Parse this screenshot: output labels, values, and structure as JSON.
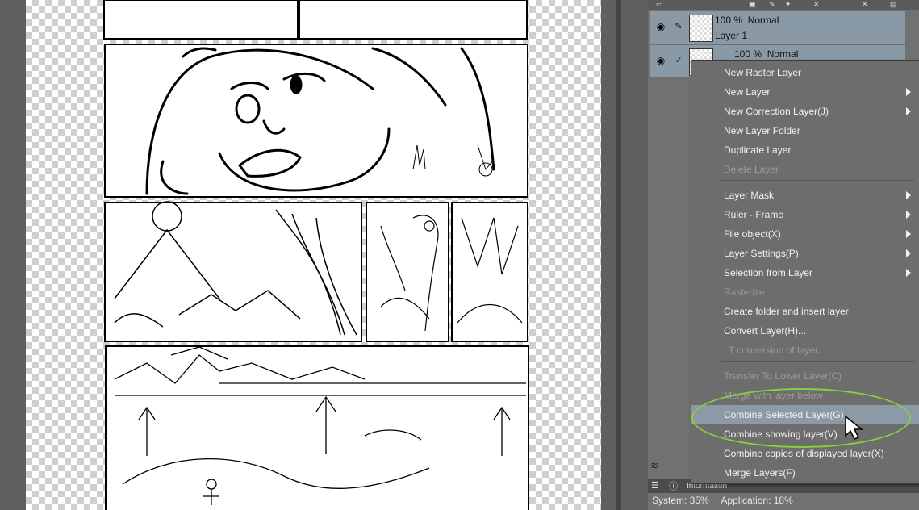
{
  "layers": [
    {
      "opacity": "100 %",
      "blend": "Normal",
      "name": "Layer 1",
      "selected": true
    },
    {
      "opacity": "100 %",
      "blend": "Normal",
      "name": "",
      "selected": true
    }
  ],
  "context_menu": {
    "items": [
      {
        "label": "New Raster Layer",
        "disabled": false,
        "submenu": false
      },
      {
        "label": "New Layer",
        "disabled": false,
        "submenu": true
      },
      {
        "label": "New Correction Layer(J)",
        "disabled": false,
        "submenu": true
      },
      {
        "label": "New Layer Folder",
        "disabled": false,
        "submenu": false
      },
      {
        "label": "Duplicate Layer",
        "disabled": false,
        "submenu": false
      },
      {
        "label": "Delete Layer",
        "disabled": true,
        "submenu": false
      },
      {
        "label": "Layer Mask",
        "disabled": false,
        "submenu": true
      },
      {
        "label": "Ruler - Frame",
        "disabled": false,
        "submenu": true
      },
      {
        "label": "File object(X)",
        "disabled": false,
        "submenu": true
      },
      {
        "label": "Layer Settings(P)",
        "disabled": false,
        "submenu": true
      },
      {
        "label": "Selection from Layer",
        "disabled": false,
        "submenu": true
      },
      {
        "label": "Rasterize",
        "disabled": true,
        "submenu": false
      },
      {
        "label": "Create folder and insert layer",
        "disabled": false,
        "submenu": false
      },
      {
        "label": "Convert Layer(H)...",
        "disabled": false,
        "submenu": false
      },
      {
        "label": "LT conversion of layer...",
        "disabled": true,
        "submenu": false
      },
      {
        "label": "Transfer To Lower Layer(C)",
        "disabled": true,
        "submenu": false
      },
      {
        "label": "Merge with layer below",
        "disabled": true,
        "submenu": false
      },
      {
        "label": "Combine Selected Layer(G)",
        "disabled": false,
        "submenu": false,
        "highlighted": true
      },
      {
        "label": "Combine showing layer(V)",
        "disabled": false,
        "submenu": false
      },
      {
        "label": "Combine copies of displayed layer(X)",
        "disabled": false,
        "submenu": false
      },
      {
        "label": "Merge Layers(F)",
        "disabled": false,
        "submenu": false
      }
    ]
  },
  "info_tab": "Information",
  "status": {
    "system": "System: 35%",
    "application": "Application: 18%"
  },
  "colors": {
    "highlight": "#8b9aa6",
    "annotation": "#86d13d",
    "panel": "#717171",
    "menu": "#6d6d6d"
  },
  "icons": [
    "eye-icon",
    "pen-icon",
    "check-icon",
    "chevron-right-icon",
    "info-icon",
    "cursor-icon"
  ]
}
